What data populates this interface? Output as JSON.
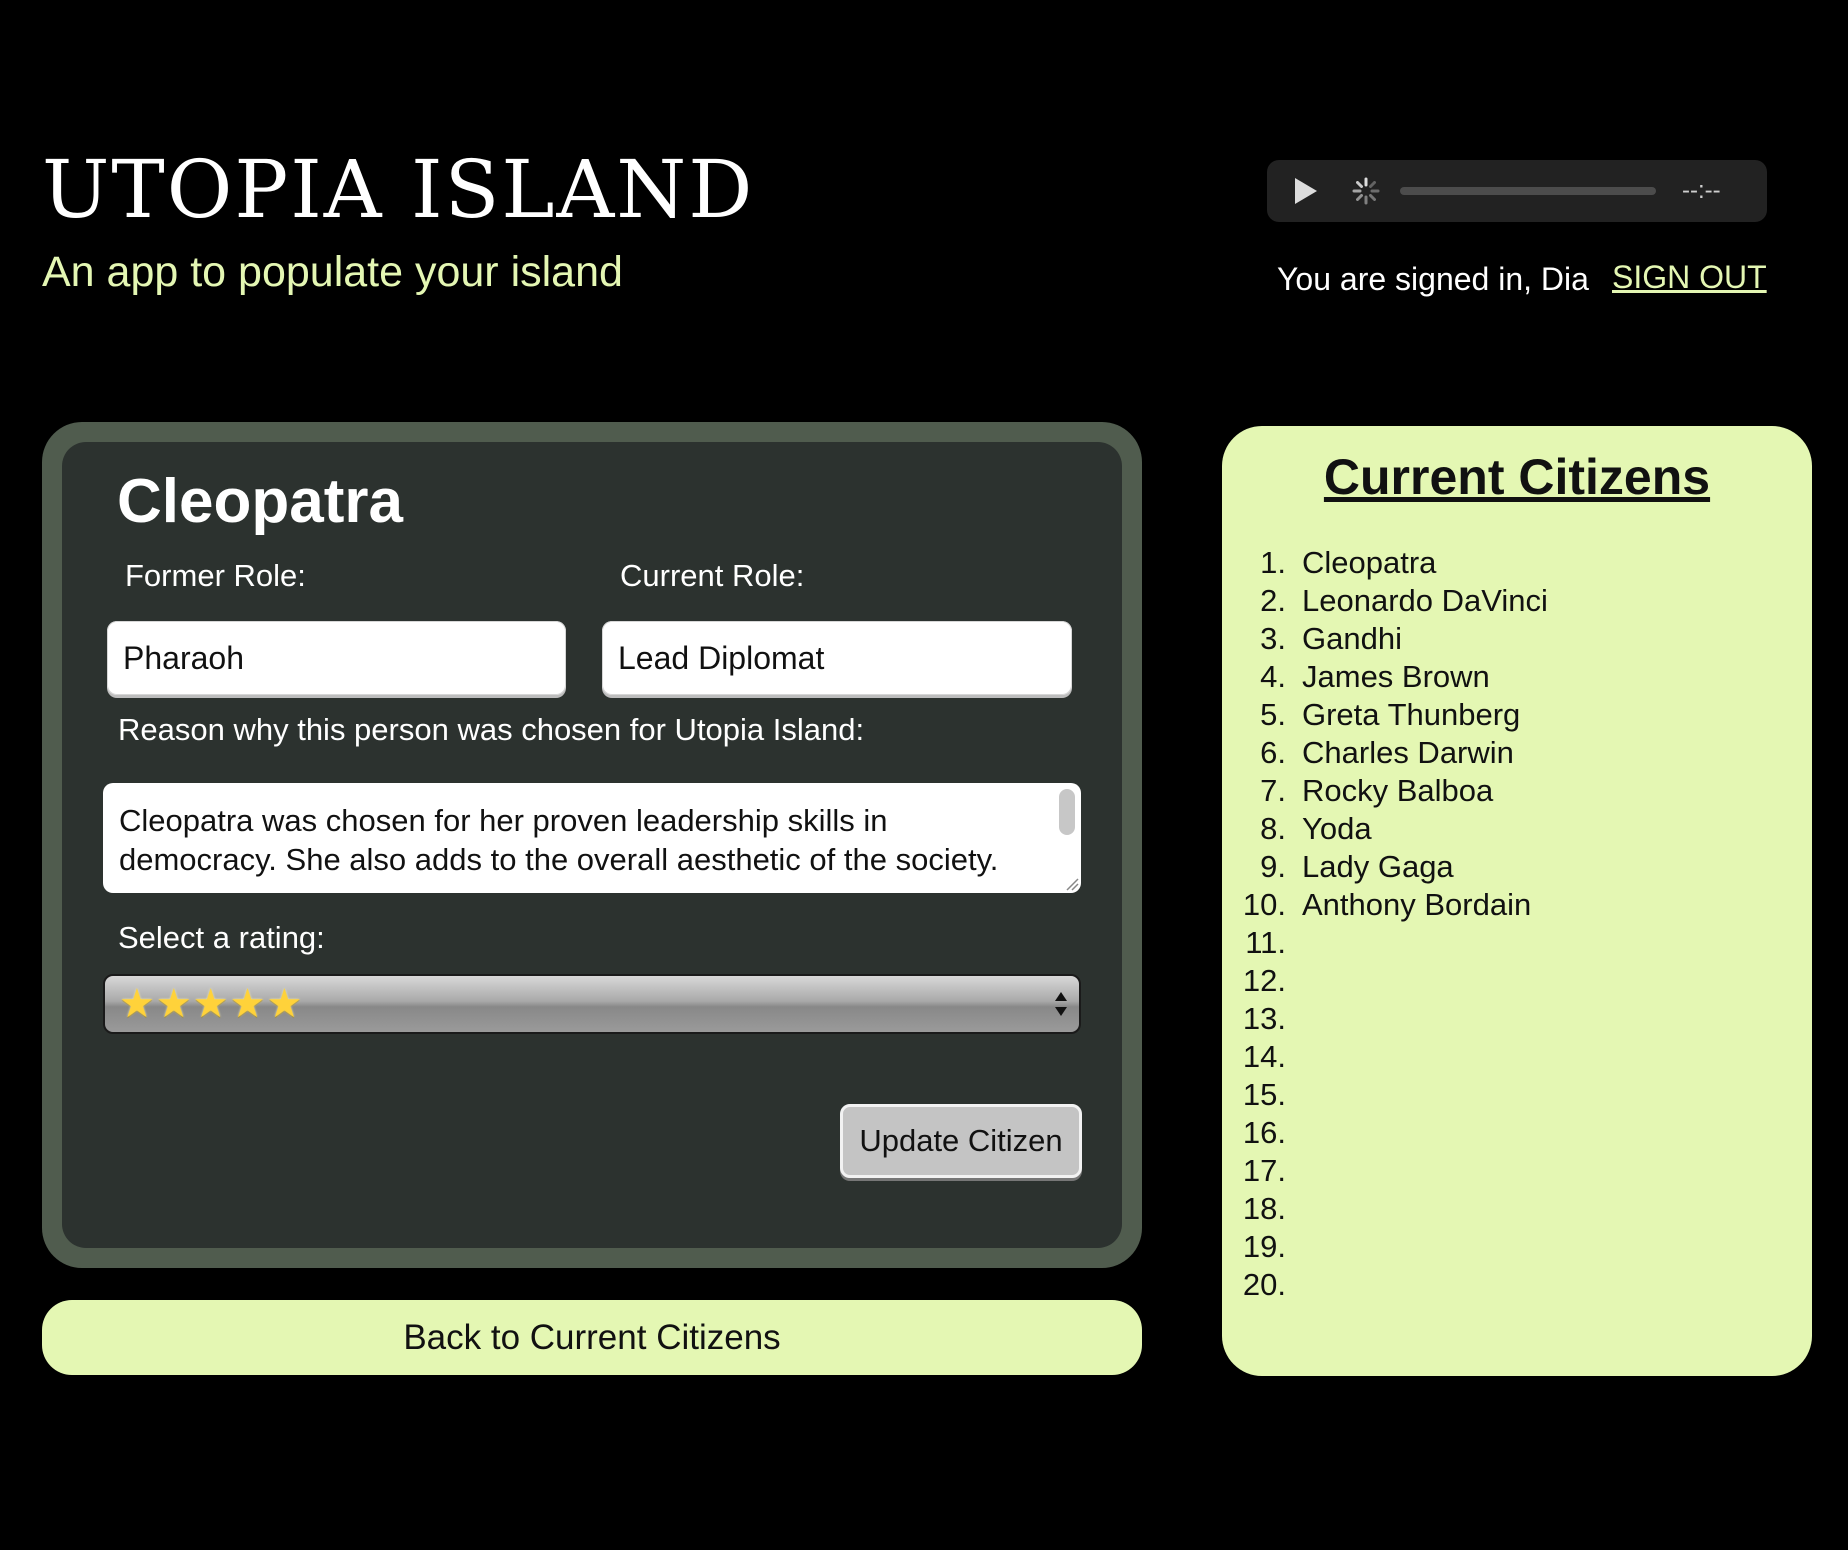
{
  "header": {
    "title": "UTOPIA ISLAND",
    "subtitle": "An app to populate your island"
  },
  "audio": {
    "time": "--:--"
  },
  "account": {
    "signed_in_text": "You are signed in, Dia",
    "sign_out_label": "SIGN OUT"
  },
  "editor": {
    "name": "Cleopatra",
    "former_role_label": "Former Role:",
    "former_role_value": "Pharaoh",
    "current_role_label": "Current Role:",
    "current_role_value": "Lead Diplomat",
    "reason_label": "Reason why this person was chosen for Utopia Island:",
    "reason_value": "Cleopatra was chosen for her proven leadership skills in democracy. She also adds to the overall aesthetic of the society.",
    "rating_label": "Select a rating:",
    "rating_value": 5,
    "rating_stars": "★★★★★",
    "update_button_label": "Update Citizen"
  },
  "back_button_label": "Back to Current Citizens",
  "citizens": {
    "title": "Current Citizens",
    "items": [
      {
        "number": "1.",
        "name": "Cleopatra"
      },
      {
        "number": "2.",
        "name": "Leonardo DaVinci"
      },
      {
        "number": "3.",
        "name": "Gandhi"
      },
      {
        "number": "4.",
        "name": "James Brown"
      },
      {
        "number": "5.",
        "name": "Greta Thunberg"
      },
      {
        "number": "6.",
        "name": "Charles Darwin"
      },
      {
        "number": "7.",
        "name": "Rocky Balboa"
      },
      {
        "number": "8.",
        "name": "Yoda"
      },
      {
        "number": "9.",
        "name": "Lady Gaga"
      },
      {
        "number": "10.",
        "name": "Anthony Bordain"
      },
      {
        "number": "11.",
        "name": ""
      },
      {
        "number": "12.",
        "name": ""
      },
      {
        "number": "13.",
        "name": ""
      },
      {
        "number": "14.",
        "name": ""
      },
      {
        "number": "15.",
        "name": ""
      },
      {
        "number": "16.",
        "name": ""
      },
      {
        "number": "17.",
        "name": ""
      },
      {
        "number": "18.",
        "name": ""
      },
      {
        "number": "19.",
        "name": ""
      },
      {
        "number": "20.",
        "name": ""
      }
    ]
  },
  "colors": {
    "background": "#000000",
    "accent": "#e4f7b3",
    "panel_frame": "#505c4e",
    "panel_inner": "#2c322f"
  },
  "icons": {
    "play": "play-icon",
    "loading": "spinner-icon",
    "select": "chevron-updown-icon"
  }
}
